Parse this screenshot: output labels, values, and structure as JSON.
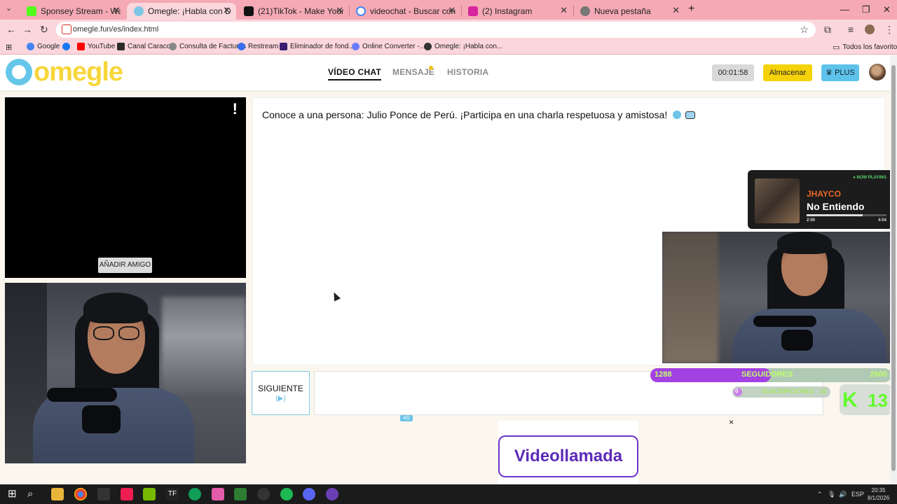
{
  "browser": {
    "tabs": [
      {
        "title": "Sponsey Stream - Watch Live o",
        "icon_color": "#53fc18",
        "active": false
      },
      {
        "title": "Omegle: ¡Habla con Descon",
        "icon_color": "#7cc8e6",
        "active": true
      },
      {
        "title": "(21)TikTok - Make Your Day",
        "icon_color": "#111111",
        "active": false
      },
      {
        "title": "videochat - Buscar con Google",
        "icon_color": "#ffffff",
        "active": false
      },
      {
        "title": "(2) Instagram",
        "icon_color": "#d6249f",
        "active": false
      },
      {
        "title": "Nueva pestaña",
        "icon_color": "#777777",
        "active": false
      }
    ],
    "url": "omegle.fun/es/index.html",
    "bookmarks": [
      {
        "label": "Google",
        "icon_color": "#4285f4"
      },
      {
        "label": "YouTube",
        "icon_color": "#ff0000"
      },
      {
        "label": "Canal Caracol",
        "icon_color": "#2b2b2b"
      },
      {
        "label": "Consulta de Facturas",
        "icon_color": "#888888"
      },
      {
        "label": "Restream",
        "icon_color": "#3a6df0"
      },
      {
        "label": "Eliminador de fond...",
        "icon_color": "#3b1c6e"
      },
      {
        "label": "Online Converter -...",
        "icon_color": "#6b7cff"
      },
      {
        "label": "Omegle: ¡Habla con...",
        "icon_color": "#333333"
      }
    ],
    "all_bookmarks_label": "Todos los favoritos"
  },
  "site": {
    "logo_text": "omegle",
    "nav": {
      "video_chat": "VÍDEO CHAT",
      "message": "MENSAJE",
      "history": "HISTORIA"
    },
    "timer": "00:01:58",
    "save_label": "Almacenar",
    "plus_label": "PLUS",
    "add_friend_label": "AÑADIR AMIGO",
    "stranger_flag": "!",
    "chat_message": "Conoce a una persona: Julio Ponce de Perú. ¡Participa en una charla respetuosa y amistosa!",
    "next_label": "SIGUIENTE",
    "next_key": "(▶)",
    "ad_tag": "AD",
    "ad_banner": "Videollamada",
    "ad_close": "×"
  },
  "overlay": {
    "now_playing_tag": "● NOW PLAYING",
    "artist": "JHAYCO",
    "song": "No Entiendo",
    "elapsed": "2:50",
    "duration": "4:04",
    "progress": 0.7,
    "followers_count": "1288",
    "followers_label": "SEGUIDORES",
    "followers_goal": "2000",
    "followers_progress": 0.5,
    "subs_count": "0",
    "subs_label": "SUSCRIPCIONES",
    "subs_goal": "10",
    "kick_letter": "K",
    "kick_number": "13"
  },
  "taskbar": {
    "lang": "ESP",
    "time": "20:35",
    "date": "8/1/2026"
  },
  "colors": {
    "tab_bar": "#f4a9b4",
    "brand_blue": "#64c6e9",
    "brand_yellow": "#f7d63a",
    "kick_green": "#53fc18"
  }
}
